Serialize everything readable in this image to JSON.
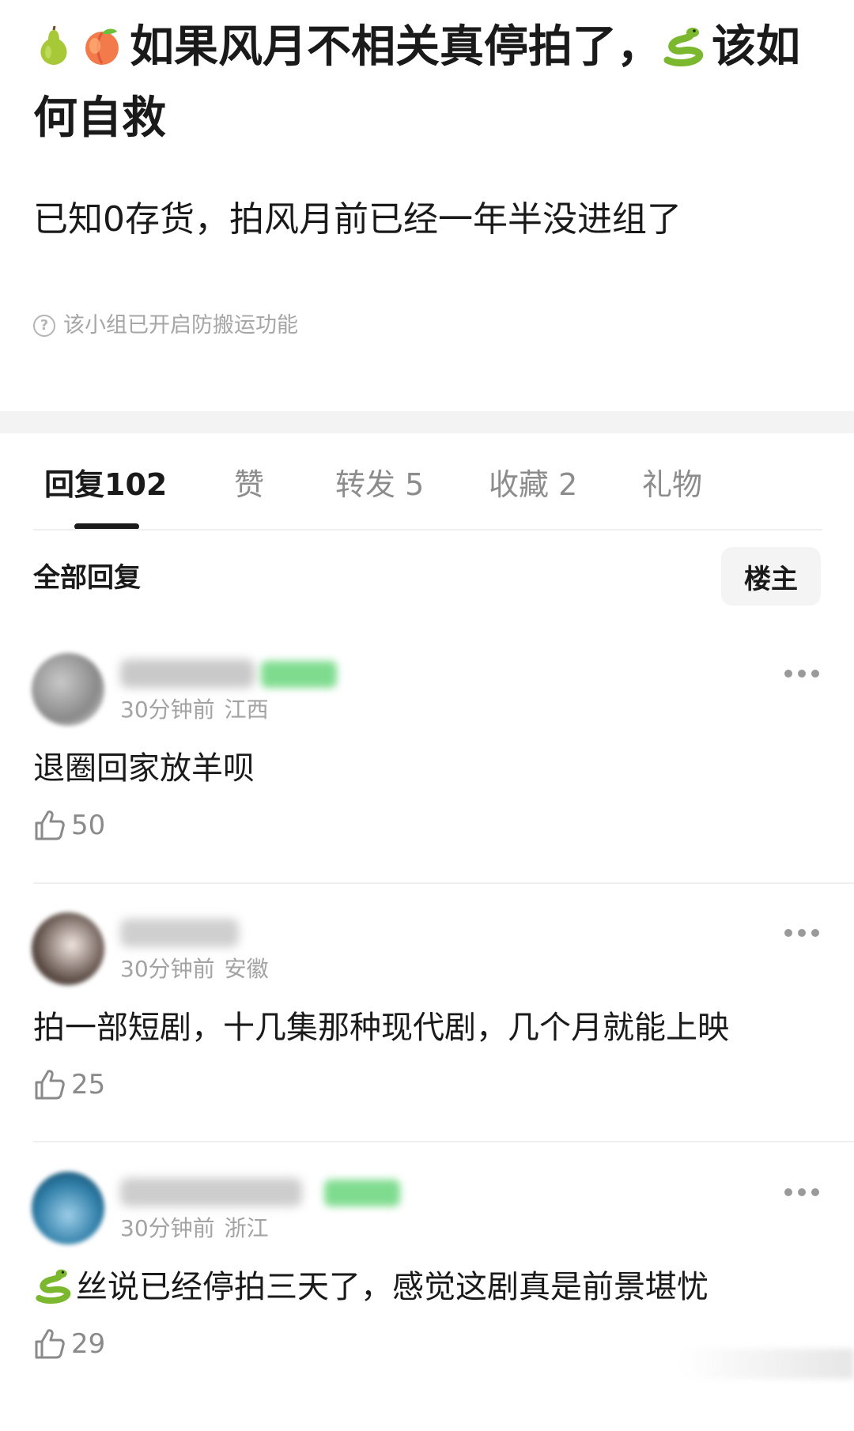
{
  "post": {
    "title": "如果风月不相关真停拍了，",
    "title_tail": "该如何自救",
    "title_emojis": [
      "pear-emoji",
      "peach-emoji",
      "snake-emoji"
    ],
    "body": "已知0存货，拍风月前已经一年半没进组了",
    "notice": "该小组已开启防搬运功能"
  },
  "tabs": [
    {
      "label": "回复",
      "count": "102",
      "active": true
    },
    {
      "label": "赞",
      "count": "",
      "active": false
    },
    {
      "label": "转发",
      "count": "5",
      "active": false
    },
    {
      "label": "收藏",
      "count": "2",
      "active": false
    },
    {
      "label": "礼物",
      "count": "",
      "active": false
    }
  ],
  "filter": {
    "label": "全部回复",
    "button": "楼主"
  },
  "comments": [
    {
      "time": "30分钟前",
      "location": "江西",
      "text": "退圈回家放羊呗",
      "likes": "50",
      "has_badge": true
    },
    {
      "time": "30分钟前",
      "location": "安徽",
      "text": "拍一部短剧，十几集那种现代剧，几个月就能上映",
      "likes": "25",
      "has_badge": false
    },
    {
      "time": "30分钟前",
      "location": "浙江",
      "text": "丝说已经停拍三天了，感觉这剧真是前景堪忧",
      "text_prefix_emoji": "snake-emoji",
      "likes": "29",
      "has_badge": true
    }
  ],
  "colors": {
    "accent": "#1a1a1a",
    "muted": "#8c8c8c",
    "badge_green": "#7fdc8f",
    "band": "#f3f3f4"
  }
}
